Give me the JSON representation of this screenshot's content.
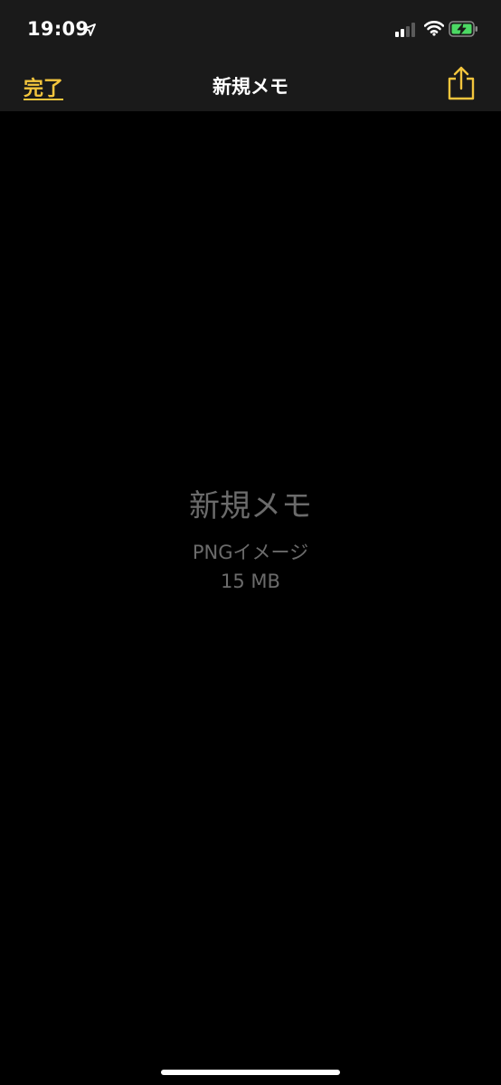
{
  "status_bar": {
    "time": "19:09"
  },
  "nav": {
    "done_label": "完了",
    "title": "新規メモ"
  },
  "file": {
    "title": "新規メモ",
    "type": "PNGイメージ",
    "size": "15 MB"
  },
  "colors": {
    "accent": "#f3c53d",
    "bar_background": "#1a1a1a",
    "background": "#000000",
    "muted_text": "#6b6b6b",
    "battery_charging": "#4cd964"
  },
  "icons": {
    "location": "location-arrow-icon",
    "signal": "cellular-signal-icon",
    "wifi": "wifi-icon",
    "battery": "battery-charging-icon",
    "share": "share-icon"
  }
}
